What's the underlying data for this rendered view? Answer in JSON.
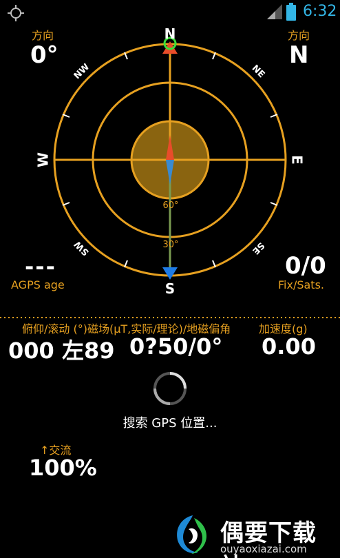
{
  "status_bar": {
    "time": "6:32",
    "icons": [
      "gps-searching-icon",
      "signal-icon",
      "battery-icon"
    ],
    "clock_color": "#33b5e5"
  },
  "compass": {
    "heading_label": "方向",
    "heading_value": "0°",
    "direction_label": "方向",
    "direction_value": "N",
    "cardinals": {
      "n": "N",
      "s": "S",
      "e": "E",
      "w": "W"
    },
    "intercardinals": {
      "ne": "NE",
      "nw": "NW",
      "se": "SE",
      "sw": "SW"
    },
    "elevation_labels": [
      "60°",
      "30°"
    ],
    "colors": {
      "ring": "#e6a020",
      "center_fill": "#8a6410",
      "north": "#e84c2a",
      "south": "#1e7be6"
    }
  },
  "agps": {
    "value": "---",
    "label": "AGPS age"
  },
  "fix": {
    "value": "0/0",
    "label": "Fix/Sats."
  },
  "sensors": {
    "pitch_roll_label": "俯仰/滚动 (°)",
    "magnetic_label": "磁场(μT,实际/理论)/地磁偏角",
    "accel_label": "加速度(g)",
    "pitch_roll_value": "000 左89",
    "magnetic_value": "0?50/0°",
    "accel_value": "0.00"
  },
  "search_status": "搜索 GPS 位置...",
  "power": {
    "label": "↑交流",
    "value": "100%"
  },
  "watermark": {
    "title": "偶要下载站",
    "url": "ouyaoxiazai.com"
  }
}
